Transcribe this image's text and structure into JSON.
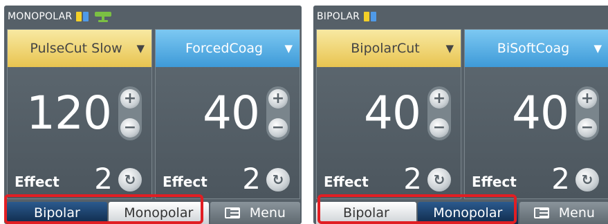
{
  "left_screen": {
    "mode_title": "MONOPOLAR",
    "cut": {
      "mode": "PulseCut Slow",
      "arrow": "▼",
      "value": "120",
      "effect_label": "Effect",
      "effect_value": "2"
    },
    "coag": {
      "mode": "ForcedCoag",
      "arrow": "▼",
      "value": "40",
      "effect_label": "Effect",
      "effect_value": "2"
    },
    "tabs": {
      "bipolar": "Bipolar",
      "monopolar": "Monopolar",
      "menu": "Menu"
    },
    "active_tab": "Bipolar"
  },
  "right_screen": {
    "mode_title": "BIPOLAR",
    "cut": {
      "mode": "BipolarCut",
      "arrow": "▼",
      "value": "40",
      "effect_label": "Effect",
      "effect_value": "2"
    },
    "coag": {
      "mode": "BiSoftCoag",
      "arrow": "▼",
      "value": "40",
      "effect_label": "Effect",
      "effect_value": "2"
    },
    "tabs": {
      "bipolar": "Bipolar",
      "monopolar": "Monopolar",
      "menu": "Menu"
    },
    "active_tab": "Monopolar"
  },
  "glyphs": {
    "plus": "+",
    "minus": "−",
    "cycle": "↻"
  },
  "colors": {
    "cut_yellow": "#e8c450",
    "coag_blue": "#3e9ad8",
    "active_tab": "#0f2a4a",
    "highlight_red": "#e11e23",
    "foot_green": "#7bc043"
  }
}
